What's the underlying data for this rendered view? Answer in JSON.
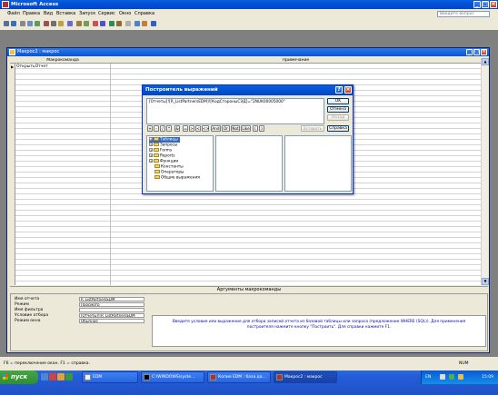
{
  "app": {
    "title": "Microsoft Access",
    "help_placeholder": "Введите вопрос",
    "menu": [
      "Файл",
      "Правка",
      "Вид",
      "Вставка",
      "Запуск",
      "Сервис",
      "Окно",
      "Справка"
    ]
  },
  "child_window": {
    "title": "Макрос2 : макрос",
    "columns": [
      "Макрокоманда",
      "Примечание"
    ],
    "rows": [
      {
        "action": "ОткрытьОтчет",
        "note": ""
      }
    ],
    "args_header": "Аргументы макрокоманды",
    "args": [
      {
        "label": "Имя отчета",
        "value": "R_ListPartnersEDM"
      },
      {
        "label": "Режим",
        "value": "Просмотр"
      },
      {
        "label": "Имя фильтра",
        "value": ""
      },
      {
        "label": "Условие отбора",
        "value": "[Отчеты]![R_ListPartnersEDM"
      },
      {
        "label": "Режим окна",
        "value": "Обычное"
      }
    ],
    "hint": "Введите условие или выражение для отбора записей отчета из базовой таблицы или запроса (предложение WHERE (SQL)). Для применения построителя нажмите кнопку \"Построить\". Для справки нажмите F1."
  },
  "dialog": {
    "title": "Построитель выражений",
    "expression": "[Отчеты]![R_ListPartnersEDM]![КодСтороныСЭД]=\"2NUK00005000\"",
    "buttons": {
      "ok": "OK",
      "cancel": "Отмена",
      "undo": "Назад",
      "insert": "Вставить",
      "help": "Справка"
    },
    "operators": [
      "+",
      "-",
      "/",
      "*",
      "&",
      "=",
      ">",
      "<",
      "<>",
      "And",
      "Or",
      "Not",
      "Like",
      "(",
      ")"
    ],
    "tree": [
      {
        "label": "Таблицы",
        "expandable": true,
        "selected": true
      },
      {
        "label": "Запросы",
        "expandable": true,
        "selected": false
      },
      {
        "label": "Forms",
        "expandable": true,
        "selected": false
      },
      {
        "label": "Reports",
        "expandable": true,
        "selected": false
      },
      {
        "label": "Функции",
        "expandable": true,
        "selected": false
      },
      {
        "label": "Константы",
        "expandable": false,
        "selected": false
      },
      {
        "label": "Операторы",
        "expandable": false,
        "selected": false
      },
      {
        "label": "Общие выражения",
        "expandable": false,
        "selected": false
      }
    ]
  },
  "status": {
    "text": "F6 = переключение окон. F1 = справка.",
    "num": "NUM"
  },
  "taskbar": {
    "start": "пуск",
    "tasks": [
      {
        "label": "EDM",
        "active": false
      },
      {
        "label": "C:\\WINDOWS\\syste...",
        "active": false
      },
      {
        "label": "Копия EDM : база да...",
        "active": false
      },
      {
        "label": "Макрос2 : макрос",
        "active": true
      }
    ],
    "lang": "EN",
    "clock": "15:09"
  }
}
